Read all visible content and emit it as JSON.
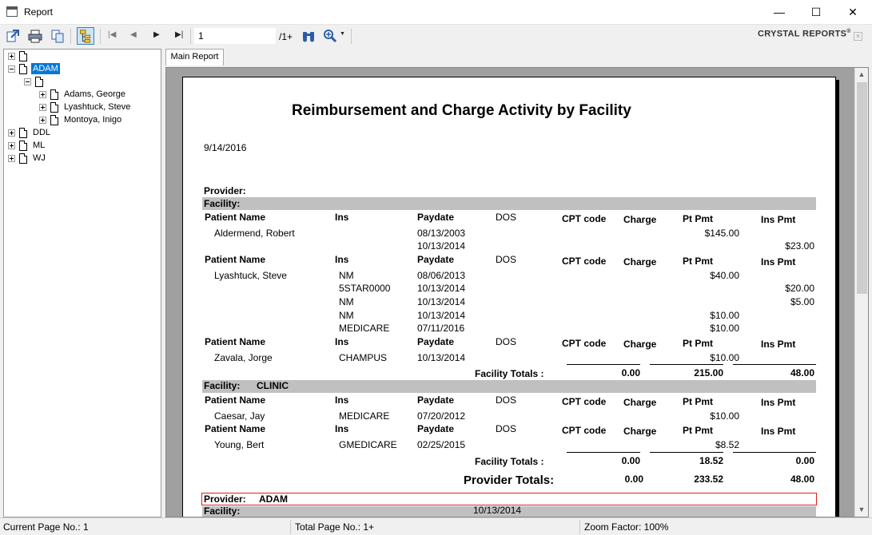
{
  "window": {
    "title": "Report",
    "minimize": "—",
    "maximize": "☐",
    "close": "✕"
  },
  "toolbar": {
    "page_value": "1",
    "page_total": "/1+",
    "brand": "CRYSTAL REPORTS",
    "brand_mark": "®"
  },
  "tree": {
    "nodes": [
      {
        "label": "",
        "expander": "plus"
      },
      {
        "label": "ADAM",
        "expander": "minus",
        "selected": true
      },
      {
        "label": "",
        "expander": "minus"
      },
      {
        "label": "Adams, George",
        "expander": "plus"
      },
      {
        "label": "Lyashtuck, Steve",
        "expander": "plus"
      },
      {
        "label": "Montoya, Inigo",
        "expander": "plus"
      },
      {
        "label": "DDL",
        "expander": "plus"
      },
      {
        "label": "ML",
        "expander": "plus"
      },
      {
        "label": "WJ",
        "expander": "plus"
      }
    ]
  },
  "tabs": {
    "main_report": "Main Report"
  },
  "report": {
    "title": "Reimbursement and Charge Activity by Facility",
    "date": "9/14/2016",
    "provider_label": "Provider:",
    "facility_label": "Facility:",
    "headers": {
      "patient": "Patient Name",
      "ins": "Ins",
      "paydate": "Paydate",
      "dos": "DOS",
      "cpt": "CPT code",
      "charge": "Charge",
      "ptpmt": "Pt Pmt",
      "inspmt": "Ins Pmt"
    },
    "group1": {
      "patients": [
        {
          "name": "Aldermend, Robert",
          "rows": [
            {
              "ins": "",
              "paydate": "08/13/2003",
              "ptpmt": "$145.00",
              "inspmt": ""
            },
            {
              "ins": "",
              "paydate": "10/13/2014",
              "ptpmt": "",
              "inspmt": "$23.00"
            }
          ]
        },
        {
          "name": "Lyashtuck, Steve",
          "rows": [
            {
              "ins": "NM",
              "paydate": "08/06/2013",
              "ptpmt": "$40.00",
              "inspmt": ""
            },
            {
              "ins": "5STAR0000",
              "paydate": "10/13/2014",
              "ptpmt": "",
              "inspmt": "$20.00"
            },
            {
              "ins": "NM",
              "paydate": "10/13/2014",
              "ptpmt": "",
              "inspmt": "$5.00"
            },
            {
              "ins": "NM",
              "paydate": "10/13/2014",
              "ptpmt": "$10.00",
              "inspmt": ""
            },
            {
              "ins": "MEDICARE",
              "paydate": "07/11/2016",
              "ptpmt": "$10.00",
              "inspmt": ""
            }
          ]
        },
        {
          "name": "Zavala, Jorge",
          "rows": [
            {
              "ins": "CHAMPUS",
              "paydate": "10/13/2014",
              "ptpmt": "$10.00",
              "inspmt": ""
            }
          ]
        }
      ],
      "totals_label": "Facility Totals :",
      "totals": {
        "charge": "0.00",
        "ptpmt": "215.00",
        "inspmt": "48.00"
      }
    },
    "group2": {
      "facility_name": "CLINIC",
      "patients": [
        {
          "name": "Caesar, Jay",
          "ins": "MEDICARE",
          "paydate": "07/20/2012",
          "ptpmt": "$10.00"
        },
        {
          "name": "Young, Bert",
          "ins": "GMEDICARE",
          "paydate": "02/25/2015",
          "ptpmt": "$8.52"
        }
      ],
      "totals_label": "Facility Totals :",
      "totals": {
        "charge": "0.00",
        "ptpmt": "18.52",
        "inspmt": "0.00"
      }
    },
    "provider_totals": {
      "label": "Provider Totals:",
      "charge": "0.00",
      "ptpmt": "233.52",
      "inspmt": "48.00"
    },
    "next_provider": {
      "label": "Provider:",
      "name": "ADAM"
    },
    "next_facility": {
      "label": "Facility:",
      "date": "10/13/2014"
    }
  },
  "status": {
    "current_page": "Current Page No.: 1",
    "total_page": "Total Page No.: 1+",
    "zoom": "Zoom Factor: 100%"
  }
}
